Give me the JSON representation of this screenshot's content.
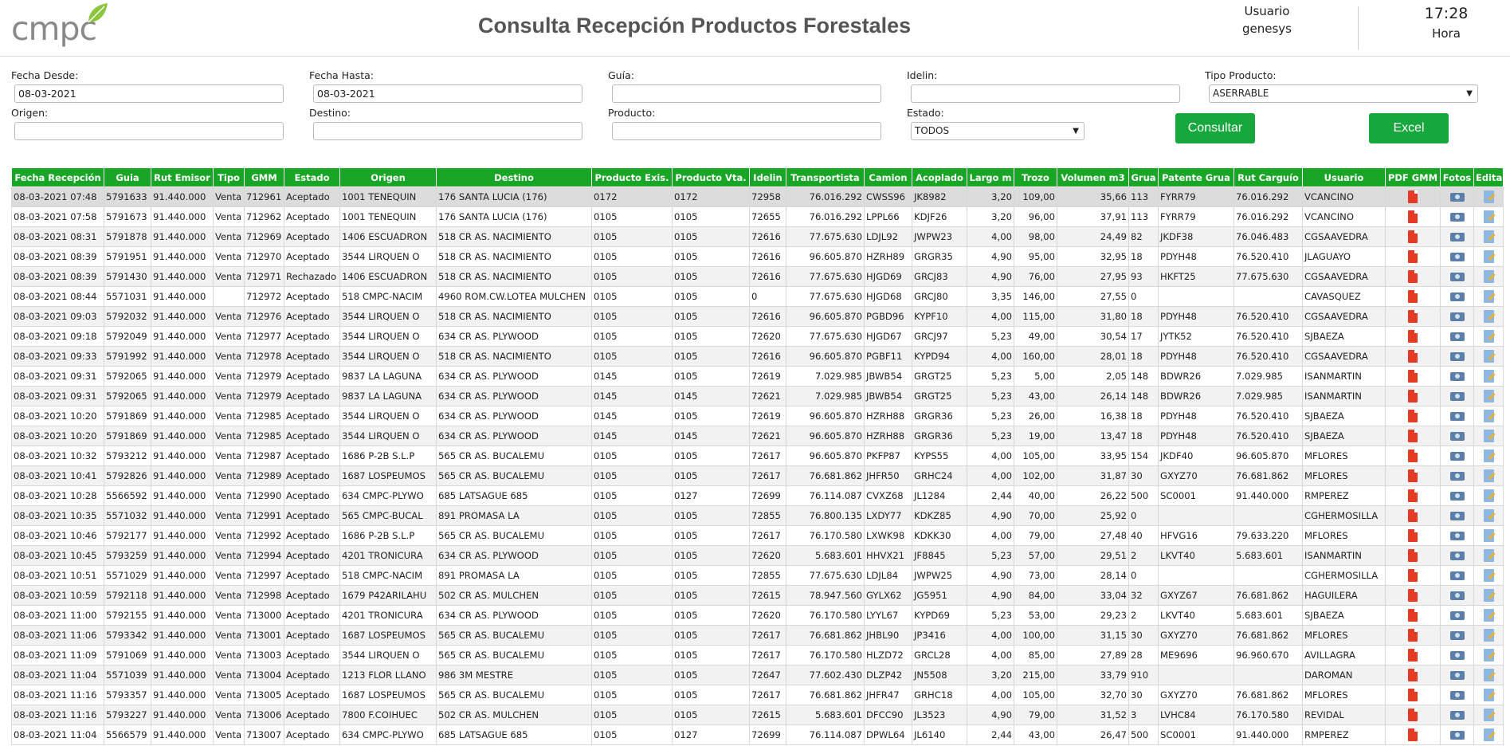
{
  "header": {
    "logo_text": "cmpc",
    "title": "Consulta Recepción Productos Forestales",
    "user_label": "Usuario",
    "user_name": "genesys",
    "time": "17:28",
    "time_label": "Hora"
  },
  "filters": {
    "fecha_desde_label": "Fecha Desde:",
    "fecha_desde_value": "08-03-2021",
    "fecha_hasta_label": "Fecha Hasta:",
    "fecha_hasta_value": "08-03-2021",
    "guia_label": "Guía:",
    "guia_value": "",
    "idelin_label": "Idelin:",
    "idelin_value": "",
    "tipo_producto_label": "Tipo Producto:",
    "tipo_producto_value": "ASERRABLE",
    "origen_label": "Origen:",
    "origen_value": "",
    "destino_label": "Destino:",
    "destino_value": "",
    "producto_label": "Producto:",
    "producto_value": "",
    "estado_label": "Estado:",
    "estado_value": "TODOS",
    "consultar_label": "Consultar",
    "excel_label": "Excel"
  },
  "colors": {
    "accent": "#19a626",
    "button": "#16a83c",
    "pdf": "#e53a24"
  },
  "table": {
    "columns": [
      "Fecha Recepción",
      "Guia",
      "Rut Emisor",
      "Tipo",
      "GMM",
      "Estado",
      "Origen",
      "Destino",
      "Producto Exis.",
      "Producto Vta.",
      "Idelin",
      "Transportista",
      "Camion",
      "Acoplado",
      "Largo m",
      "Trozo",
      "Volumen m3",
      "Grua",
      "Patente Grua",
      "Rut Carguío",
      "Usuario",
      "PDF GMM",
      "Fotos",
      "Editar"
    ],
    "rows": [
      [
        "08-03-2021 07:48",
        "5791633",
        "91.440.000",
        "Venta",
        "712961",
        "Aceptado",
        "1001 TENEQUIN",
        "176 SANTA LUCIA (176)",
        "0172",
        "0172",
        "72958",
        "76.016.292",
        "CWSS96",
        "JK8982",
        "3,20",
        "109,00",
        "35,66",
        "113",
        "FYRR79",
        "76.016.292",
        "VCANCINO"
      ],
      [
        "08-03-2021 07:58",
        "5791673",
        "91.440.000",
        "Venta",
        "712962",
        "Aceptado",
        "1001 TENEQUIN",
        "176 SANTA LUCIA (176)",
        "0105",
        "0105",
        "72655",
        "76.016.292",
        "LPPL66",
        "KDJF26",
        "3,20",
        "96,00",
        "37,91",
        "113",
        "FYRR79",
        "76.016.292",
        "VCANCINO"
      ],
      [
        "08-03-2021 08:31",
        "5791878",
        "91.440.000",
        "Venta",
        "712969",
        "Aceptado",
        "1406 ESCUADRON",
        "518 CR AS. NACIMIENTO",
        "0105",
        "0105",
        "72616",
        "77.675.630",
        "LDJL92",
        "JWPW23",
        "4,00",
        "98,00",
        "24,49",
        "82",
        "JKDF38",
        "76.046.483",
        "CGSAAVEDRA"
      ],
      [
        "08-03-2021 08:39",
        "5791951",
        "91.440.000",
        "Venta",
        "712970",
        "Aceptado",
        "3544 LIRQUEN O",
        "518 CR AS. NACIMIENTO",
        "0105",
        "0105",
        "72616",
        "96.605.870",
        "HZRH89",
        "GRGR35",
        "4,90",
        "95,00",
        "32,95",
        "18",
        "PDYH48",
        "76.520.410",
        "JLAGUAYO"
      ],
      [
        "08-03-2021 08:39",
        "5791430",
        "91.440.000",
        "Venta",
        "712971",
        "Rechazado",
        "1406 ESCUADRON",
        "518 CR AS. NACIMIENTO",
        "0105",
        "0105",
        "72616",
        "77.675.630",
        "HJGD69",
        "GRCJ83",
        "4,90",
        "76,00",
        "27,95",
        "93",
        "HKFT25",
        "77.675.630",
        "CGSAAVEDRA"
      ],
      [
        "08-03-2021 08:44",
        "5571031",
        "91.440.000",
        "",
        "712972",
        "Aceptado",
        "518 CMPC-NACIM",
        "4960 ROM.CW.LOTEA MULCHEN",
        "0105",
        "0105",
        "0",
        "77.675.630",
        "HJGD68",
        "GRCJ80",
        "3,35",
        "146,00",
        "27,55",
        "0",
        "",
        "",
        "CAVASQUEZ"
      ],
      [
        "08-03-2021 09:03",
        "5792032",
        "91.440.000",
        "Venta",
        "712976",
        "Aceptado",
        "3544 LIRQUEN O",
        "518 CR AS. NACIMIENTO",
        "0105",
        "0105",
        "72616",
        "96.605.870",
        "PGBD96",
        "KYPF10",
        "4,00",
        "115,00",
        "31,80",
        "18",
        "PDYH48",
        "76.520.410",
        "CGSAAVEDRA"
      ],
      [
        "08-03-2021 09:18",
        "5792049",
        "91.440.000",
        "Venta",
        "712977",
        "Aceptado",
        "3544 LIRQUEN O",
        "634 CR AS. PLYWOOD",
        "0105",
        "0105",
        "72620",
        "77.675.630",
        "HJGD67",
        "GRCJ97",
        "5,23",
        "49,00",
        "30,54",
        "17",
        "JYTK52",
        "76.520.410",
        "SJBAEZA"
      ],
      [
        "08-03-2021 09:33",
        "5791992",
        "91.440.000",
        "Venta",
        "712978",
        "Aceptado",
        "3544 LIRQUEN O",
        "518 CR AS. NACIMIENTO",
        "0105",
        "0105",
        "72616",
        "96.605.870",
        "PGBF11",
        "KYPD94",
        "4,00",
        "160,00",
        "28,01",
        "18",
        "PDYH48",
        "76.520.410",
        "CGSAAVEDRA"
      ],
      [
        "08-03-2021 09:31",
        "5792065",
        "91.440.000",
        "Venta",
        "712979",
        "Aceptado",
        "9837 LA LAGUNA",
        "634 CR AS. PLYWOOD",
        "0145",
        "0105",
        "72619",
        "7.029.985",
        "JBWB54",
        "GRGT25",
        "5,23",
        "5,00",
        "2,05",
        "148",
        "BDWR26",
        "7.029.985",
        "ISANMARTIN"
      ],
      [
        "08-03-2021 09:31",
        "5792065",
        "91.440.000",
        "Venta",
        "712979",
        "Aceptado",
        "9837 LA LAGUNA",
        "634 CR AS. PLYWOOD",
        "0145",
        "0145",
        "72621",
        "7.029.985",
        "JBWB54",
        "GRGT25",
        "5,23",
        "43,00",
        "26,14",
        "148",
        "BDWR26",
        "7.029.985",
        "ISANMARTIN"
      ],
      [
        "08-03-2021 10:20",
        "5791869",
        "91.440.000",
        "Venta",
        "712985",
        "Aceptado",
        "3544 LIRQUEN O",
        "634 CR AS. PLYWOOD",
        "0145",
        "0105",
        "72619",
        "96.605.870",
        "HZRH88",
        "GRGR36",
        "5,23",
        "26,00",
        "16,38",
        "18",
        "PDYH48",
        "76.520.410",
        "SJBAEZA"
      ],
      [
        "08-03-2021 10:20",
        "5791869",
        "91.440.000",
        "Venta",
        "712985",
        "Aceptado",
        "3544 LIRQUEN O",
        "634 CR AS. PLYWOOD",
        "0145",
        "0145",
        "72621",
        "96.605.870",
        "HZRH88",
        "GRGR36",
        "5,23",
        "19,00",
        "13,47",
        "18",
        "PDYH48",
        "76.520.410",
        "SJBAEZA"
      ],
      [
        "08-03-2021 10:32",
        "5793212",
        "91.440.000",
        "Venta",
        "712987",
        "Aceptado",
        "1686 P-2B S.L.P",
        "565 CR AS. BUCALEMU",
        "0105",
        "0105",
        "72617",
        "96.605.870",
        "PKFP87",
        "KYPS55",
        "4,00",
        "105,00",
        "33,95",
        "154",
        "JKDF40",
        "96.605.870",
        "MFLORES"
      ],
      [
        "08-03-2021 10:41",
        "5792826",
        "91.440.000",
        "Venta",
        "712989",
        "Aceptado",
        "1687 LOSPEUMOS",
        "565 CR AS. BUCALEMU",
        "0105",
        "0105",
        "72617",
        "76.681.862",
        "JHFR50",
        "GRHC24",
        "4,00",
        "102,00",
        "31,87",
        "30",
        "GXYZ70",
        "76.681.862",
        "MFLORES"
      ],
      [
        "08-03-2021 10:28",
        "5566592",
        "91.440.000",
        "Venta",
        "712990",
        "Aceptado",
        "634 CMPC-PLYWO",
        "685 LATSAGUE 685",
        "0105",
        "0127",
        "72699",
        "76.114.087",
        "CVXZ68",
        "JL1284",
        "2,44",
        "40,00",
        "26,22",
        "500",
        "SC0001",
        "91.440.000",
        "RMPEREZ"
      ],
      [
        "08-03-2021 10:35",
        "5571032",
        "91.440.000",
        "Venta",
        "712991",
        "Aceptado",
        "565 CMPC-BUCAL",
        "891 PROMASA LA",
        "0105",
        "0105",
        "72855",
        "76.800.135",
        "LXDY77",
        "KDKZ85",
        "4,90",
        "70,00",
        "25,92",
        "0",
        "",
        "",
        "CGHERMOSILLA"
      ],
      [
        "08-03-2021 10:46",
        "5792177",
        "91.440.000",
        "Venta",
        "712992",
        "Aceptado",
        "1686 P-2B S.L.P",
        "565 CR AS. BUCALEMU",
        "0105",
        "0105",
        "72617",
        "76.170.580",
        "LXWK98",
        "KDKK30",
        "4,00",
        "79,00",
        "27,48",
        "40",
        "HFVG16",
        "79.633.220",
        "MFLORES"
      ],
      [
        "08-03-2021 10:45",
        "5793259",
        "91.440.000",
        "Venta",
        "712994",
        "Aceptado",
        "4201 TRONICURA",
        "634 CR AS. PLYWOOD",
        "0105",
        "0105",
        "72620",
        "5.683.601",
        "HHVX21",
        "JF8845",
        "5,23",
        "57,00",
        "29,51",
        "2",
        "LKVT40",
        "5.683.601",
        "ISANMARTIN"
      ],
      [
        "08-03-2021 10:51",
        "5571029",
        "91.440.000",
        "Venta",
        "712997",
        "Aceptado",
        "518 CMPC-NACIM",
        "891 PROMASA LA",
        "0105",
        "0105",
        "72855",
        "77.675.630",
        "LDJL84",
        "JWPW25",
        "4,90",
        "73,00",
        "28,14",
        "0",
        "",
        "",
        "CGHERMOSILLA"
      ],
      [
        "08-03-2021 10:59",
        "5792118",
        "91.440.000",
        "Venta",
        "712998",
        "Aceptado",
        "1679 P42ARILAHU",
        "502 CR AS. MULCHEN",
        "0105",
        "0105",
        "72615",
        "78.947.560",
        "GYLX62",
        "JG5951",
        "4,90",
        "84,00",
        "33,04",
        "32",
        "GXYZ67",
        "76.681.862",
        "HAGUILERA"
      ],
      [
        "08-03-2021 11:00",
        "5792155",
        "91.440.000",
        "Venta",
        "713000",
        "Aceptado",
        "4201 TRONICURA",
        "634 CR AS. PLYWOOD",
        "0105",
        "0105",
        "72620",
        "76.170.580",
        "LYYL67",
        "KYPD69",
        "5,23",
        "53,00",
        "29,23",
        "2",
        "LKVT40",
        "5.683.601",
        "SJBAEZA"
      ],
      [
        "08-03-2021 11:06",
        "5793342",
        "91.440.000",
        "Venta",
        "713001",
        "Aceptado",
        "1687 LOSPEUMOS",
        "565 CR AS. BUCALEMU",
        "0105",
        "0105",
        "72617",
        "76.681.862",
        "JHBL90",
        "JP3416",
        "4,00",
        "100,00",
        "31,15",
        "30",
        "GXYZ70",
        "76.681.862",
        "MFLORES"
      ],
      [
        "08-03-2021 11:09",
        "5791069",
        "91.440.000",
        "Venta",
        "713003",
        "Aceptado",
        "3544 LIRQUEN O",
        "565 CR AS. BUCALEMU",
        "0105",
        "0105",
        "72617",
        "76.170.580",
        "HLZD72",
        "GRCL28",
        "4,00",
        "85,00",
        "27,89",
        "28",
        "ME9696",
        "96.960.670",
        "AVILLAGRA"
      ],
      [
        "08-03-2021 11:04",
        "5571039",
        "91.440.000",
        "Venta",
        "713004",
        "Aceptado",
        "1213 FLOR LLANO",
        "986 3M MESTRE",
        "0105",
        "0105",
        "72647",
        "77.602.430",
        "DLZP42",
        "JN5508",
        "3,20",
        "215,00",
        "33,79",
        "910",
        "",
        "",
        "DAROMAN"
      ],
      [
        "08-03-2021 11:16",
        "5793357",
        "91.440.000",
        "Venta",
        "713005",
        "Aceptado",
        "1687 LOSPEUMOS",
        "565 CR AS. BUCALEMU",
        "0105",
        "0105",
        "72617",
        "76.681.862",
        "JHFR47",
        "GRHC18",
        "4,00",
        "105,00",
        "32,70",
        "30",
        "GXYZ70",
        "76.681.862",
        "MFLORES"
      ],
      [
        "08-03-2021 11:16",
        "5793227",
        "91.440.000",
        "Venta",
        "713006",
        "Aceptado",
        "7800 F.COIHUEC",
        "502 CR AS. MULCHEN",
        "0105",
        "0105",
        "72615",
        "5.683.601",
        "DFCC90",
        "JL3523",
        "4,90",
        "79,00",
        "31,52",
        "3",
        "LVHC84",
        "76.170.580",
        "REVIDAL"
      ],
      [
        "08-03-2021 11:04",
        "5566579",
        "91.440.000",
        "Venta",
        "713007",
        "Aceptado",
        "634 CMPC-PLYWO",
        "685 LATSAGUE 685",
        "0105",
        "0127",
        "72699",
        "76.114.087",
        "DPWL64",
        "JL6140",
        "2,44",
        "43,00",
        "26,47",
        "500",
        "SC0001",
        "91.440.000",
        "RMPEREZ"
      ]
    ]
  }
}
